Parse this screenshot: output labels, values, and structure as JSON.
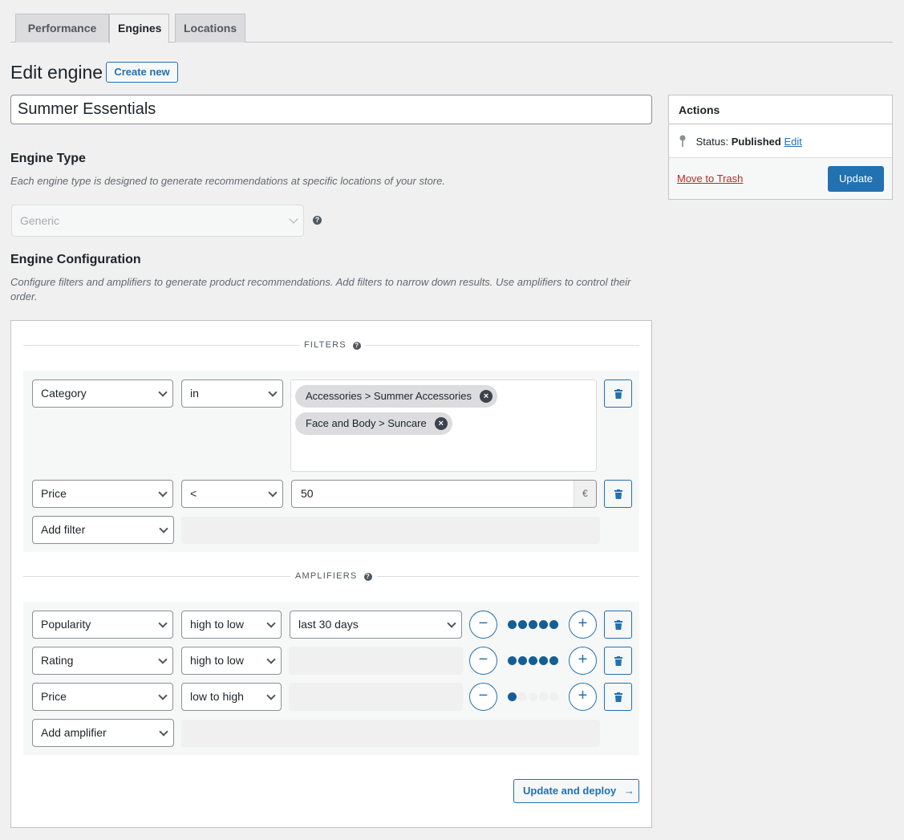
{
  "tabs": [
    {
      "label": "Performance",
      "active": false
    },
    {
      "label": "Engines",
      "active": true
    },
    {
      "label": "Locations",
      "active": false
    }
  ],
  "header": {
    "title": "Edit engine",
    "create_new": "Create new"
  },
  "engine_name": "Summer Essentials",
  "engine_type": {
    "heading": "Engine Type",
    "description": "Each engine type is designed to generate recommendations at specific locations of your store.",
    "selected": "Generic",
    "help": "?"
  },
  "engine_config": {
    "heading": "Engine Configuration",
    "description": "Configure filters and amplifiers to generate product recommendations. Add filters to narrow down results. Use amplifiers to control their order."
  },
  "filters": {
    "label": "FILTERS",
    "rows": [
      {
        "field": "Category",
        "operator": "in",
        "tags": [
          "Accessories > Summer Accessories",
          "Face and Body > Suncare"
        ]
      },
      {
        "field": "Price",
        "operator": "<",
        "value": "50",
        "suffix": "€"
      }
    ],
    "add_label": "Add filter"
  },
  "amplifiers": {
    "label": "AMPLIFIERS",
    "rows": [
      {
        "field": "Popularity",
        "order": "high to low",
        "period": "last 30 days",
        "weight": 5,
        "max_weight": 5
      },
      {
        "field": "Rating",
        "order": "high to low",
        "period": "",
        "weight": 5,
        "max_weight": 5
      },
      {
        "field": "Price",
        "order": "low to high",
        "period": "",
        "weight": 1,
        "max_weight": 5
      }
    ],
    "add_label": "Add amplifier",
    "minus": "−",
    "plus": "+"
  },
  "deploy_button": "Update and deploy",
  "actions": {
    "heading": "Actions",
    "status_label": "Status:",
    "status_value": "Published",
    "edit_link": "Edit",
    "trash_link": "Move to Trash",
    "update_button": "Update"
  },
  "colors": {
    "accent": "#2271b1",
    "dot_active": "#135e96",
    "danger": "#b32d2e"
  }
}
